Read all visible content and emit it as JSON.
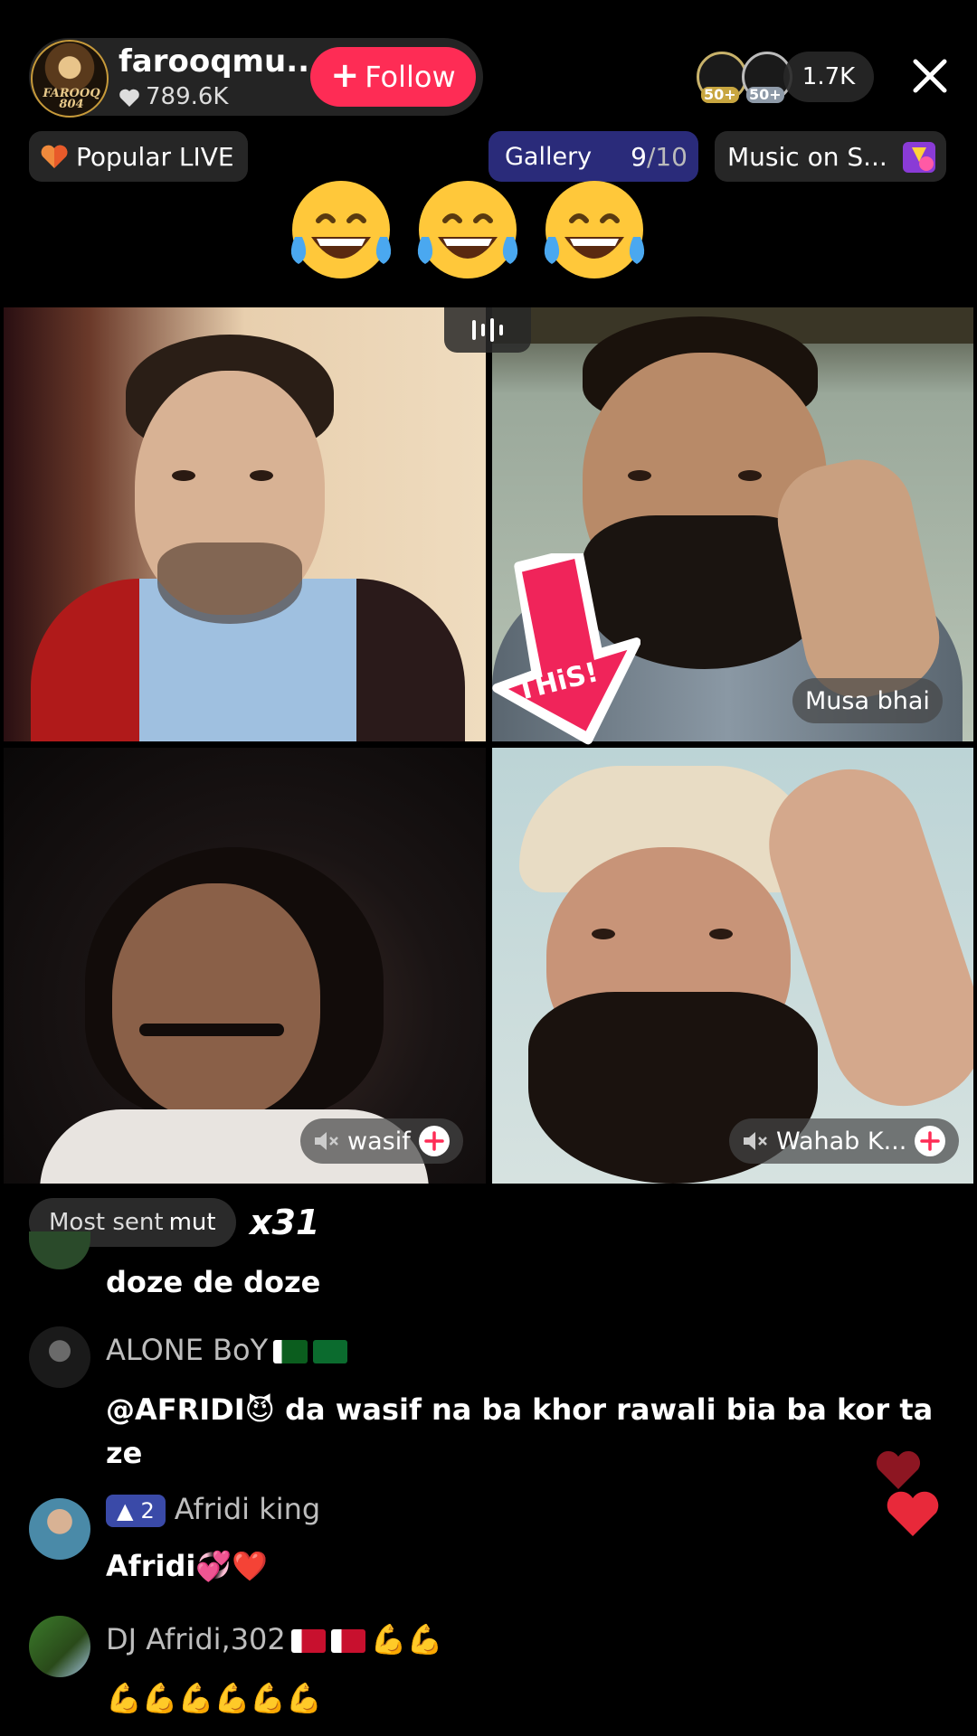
{
  "header": {
    "host_name": "farooqmu...",
    "host_likes": "789.6K",
    "avatar_tag": "FAROOQ 804",
    "follow_label": "Follow",
    "viewer_badges": [
      "50+",
      "50+"
    ],
    "viewer_count": "1.7K"
  },
  "tags": {
    "popular_label": "Popular LIVE",
    "gallery_label": "Gallery",
    "gallery_current": "9",
    "gallery_total": "/10",
    "music_label": "Music on S..."
  },
  "participants": [
    {
      "name": ""
    },
    {
      "name": "Musa bhai"
    },
    {
      "name": "wasif"
    },
    {
      "name": "Wahab K..."
    }
  ],
  "sticker_text": "THiS!",
  "gift_summary": {
    "label": "Most sent",
    "gift": "mut",
    "count": "x31"
  },
  "comments": [
    {
      "user": "",
      "text": "doze de doze"
    },
    {
      "user": "ALONE BoY",
      "text": "@AFRIDI😈 da wasif na ba khor rawali bia ba kor ta ze"
    },
    {
      "user": "Afridi king",
      "level": "2",
      "text": "Afridi💞❤️"
    },
    {
      "user": "DJ Afridi,302",
      "text": "💪💪💪💪💪💪"
    }
  ],
  "colors": {
    "follow": "#fe2c55",
    "gallery_bg": "#2a2b7a",
    "sticker": "#f0245a",
    "heart": "#e8293a"
  }
}
